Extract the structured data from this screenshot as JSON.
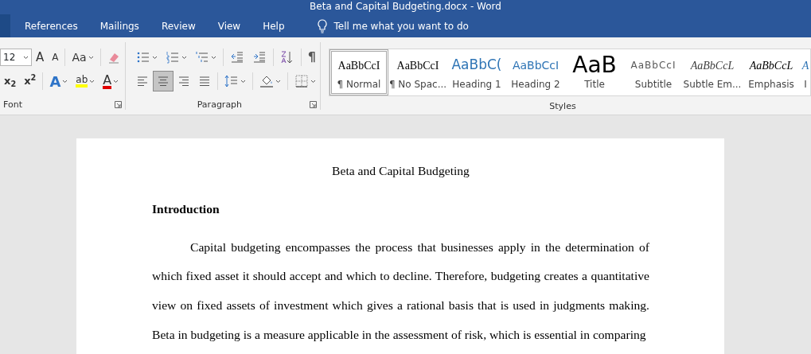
{
  "window": {
    "title": "Beta and Capital Budgeting.docx  -  Word"
  },
  "tabs": [
    {
      "label": "References"
    },
    {
      "label": "Mailings"
    },
    {
      "label": "Review"
    },
    {
      "label": "View"
    },
    {
      "label": "Help"
    }
  ],
  "tell_me": {
    "placeholder": "Tell me what you want to do"
  },
  "ribbon": {
    "font": {
      "label": "Font",
      "size": "12",
      "row_1": [
        {
          "kind": "grow",
          "glyph": "A",
          "dropdown": false
        },
        {
          "kind": "shrink",
          "glyph": "A",
          "dropdown": false
        },
        {
          "kind": "case",
          "glyph": "Aa",
          "dropdown": true
        },
        {
          "kind": "clear",
          "dropdown": false
        }
      ],
      "row_2": [
        {
          "kind": "subscript",
          "glyph": "x$_{2}$",
          "dropdown": false
        },
        {
          "kind": "superscript",
          "glyph": "x$^{2}$",
          "dropdown": false
        },
        {
          "kind": "effects",
          "glyph": "A",
          "dropdown": true
        },
        {
          "kind": "highlight",
          "glyph": "ab",
          "dropdown": true
        },
        {
          "kind": "color",
          "glyph": "A",
          "dropdown": true
        }
      ]
    },
    "paragraph": {
      "label": "Paragraph",
      "row_1": [
        {
          "kind": "bullets",
          "dropdown": true
        },
        {
          "kind": "numbering",
          "dropdown": true
        },
        {
          "kind": "multilevel",
          "dropdown": true
        },
        {
          "kind": "outdent",
          "dropdown": false
        },
        {
          "kind": "indent",
          "dropdown": false
        },
        {
          "kind": "sort",
          "dropdown": false
        },
        {
          "kind": "pilcrow",
          "glyph": "¶",
          "dropdown": false
        }
      ],
      "alignment": [
        {
          "kind": "left",
          "selected": false
        },
        {
          "kind": "center",
          "selected": true
        },
        {
          "kind": "right",
          "selected": false
        },
        {
          "kind": "justify",
          "selected": false
        }
      ],
      "row_2": [
        {
          "kind": "spacing",
          "dropdown": true
        },
        {
          "kind": "shading",
          "dropdown": true
        },
        {
          "kind": "borders",
          "dropdown": true
        }
      ]
    },
    "styles": {
      "label": "Styles",
      "items": [
        {
          "kind": "normal",
          "preview": "AaBbCcI",
          "name": "¶ Normal",
          "selected": true
        },
        {
          "kind": "nospacing",
          "preview": "AaBbCcI",
          "name": "¶ No Spac...",
          "selected": false
        },
        {
          "kind": "heading1",
          "preview": "AaBbC(",
          "name": "Heading 1",
          "selected": false
        },
        {
          "kind": "heading2",
          "preview": "AaBbCcI",
          "name": "Heading 2",
          "selected": false
        },
        {
          "kind": "title",
          "preview": "AaB",
          "name": "Title",
          "selected": false
        },
        {
          "kind": "subtitle",
          "preview": "AaBbCcI",
          "name": "Subtitle",
          "selected": false
        },
        {
          "kind": "subtle",
          "preview": "AaBbCcL",
          "name": "Subtle Em...",
          "selected": false
        },
        {
          "kind": "emphasis",
          "preview": "AaBbCcL",
          "name": "Emphasis",
          "selected": false
        },
        {
          "kind": "intense",
          "preview": "A",
          "name": "I",
          "selected": false
        }
      ]
    }
  },
  "document": {
    "title": "Beta and Capital Budgeting",
    "heading": "Introduction",
    "paragraph": "Capital budgeting encompasses the process that businesses apply in the determination of which fixed asset it should accept and which to decline. Therefore, budgeting creates a quantitative view on fixed assets of investment which gives a rational basis that is used in judgments making. Beta in budgeting is a measure applicable in the assessment of risk, which is essential in comparing"
  }
}
